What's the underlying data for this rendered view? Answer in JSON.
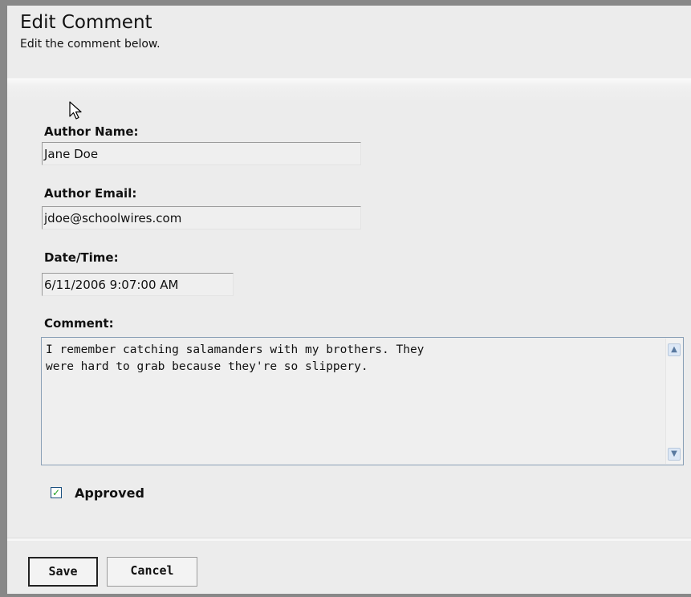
{
  "header": {
    "title": "Edit Comment",
    "subtitle": "Edit the comment below."
  },
  "form": {
    "author_name": {
      "label": "Author Name:",
      "value": "Jane Doe"
    },
    "author_email": {
      "label": "Author Email:",
      "value": "jdoe@schoolwires.com"
    },
    "date_time": {
      "label": "Date/Time:",
      "value": "6/11/2006 9:07:00 AM"
    },
    "comment": {
      "label": "Comment:",
      "value": "I remember catching salamanders with my brothers. They\nwere hard to grab because they're so slippery."
    },
    "approved": {
      "label": "Approved",
      "checked": true
    }
  },
  "buttons": {
    "save": "Save",
    "cancel": "Cancel"
  }
}
